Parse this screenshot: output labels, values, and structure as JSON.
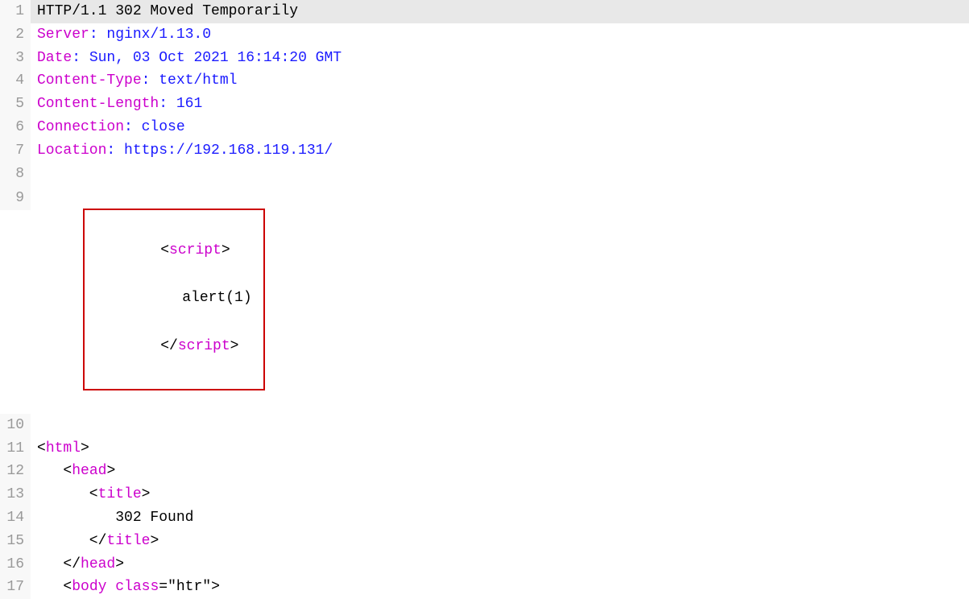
{
  "lines": [
    {
      "number": "1",
      "parts": [
        {
          "text": "HTTP/1.1 302 Moved Temporarily",
          "class": "plain"
        }
      ],
      "bg": "gray"
    },
    {
      "number": "2",
      "parts": [
        {
          "text": "Server",
          "class": "keyword"
        },
        {
          "text": ": nginx/1.13.0",
          "class": "value"
        }
      ],
      "bg": "white"
    },
    {
      "number": "3",
      "parts": [
        {
          "text": "Date",
          "class": "keyword"
        },
        {
          "text": ": Sun, 03 Oct 2021 16:14:20 GMT",
          "class": "value"
        }
      ],
      "bg": "white"
    },
    {
      "number": "4",
      "parts": [
        {
          "text": "Content-Type",
          "class": "keyword"
        },
        {
          "text": ": text/html",
          "class": "value"
        }
      ],
      "bg": "white"
    },
    {
      "number": "5",
      "parts": [
        {
          "text": "Content-Length",
          "class": "keyword"
        },
        {
          "text": ": 161",
          "class": "value"
        }
      ],
      "bg": "white"
    },
    {
      "number": "6",
      "parts": [
        {
          "text": "Connection",
          "class": "keyword"
        },
        {
          "text": ": close",
          "class": "value"
        }
      ],
      "bg": "white"
    },
    {
      "number": "7",
      "parts": [
        {
          "text": "Location",
          "class": "keyword"
        },
        {
          "text": ": https://192.168.119.131/",
          "class": "value"
        }
      ],
      "bg": "white"
    },
    {
      "number": "8",
      "parts": [],
      "bg": "white"
    },
    {
      "number": "9",
      "highlighted": true,
      "parts": [
        {
          "text": "<",
          "class": "keyword"
        },
        {
          "text": "script",
          "class": "keyword"
        },
        {
          "text": ">",
          "class": "keyword"
        }
      ],
      "inner_line": "    alert(1)",
      "close_parts": [
        {
          "text": "</",
          "class": "keyword"
        },
        {
          "text": "script",
          "class": "keyword"
        },
        {
          "text": ">",
          "class": "keyword"
        }
      ],
      "bg": "white"
    },
    {
      "number": "10",
      "parts": [],
      "bg": "white"
    },
    {
      "number": "11",
      "parts": [
        {
          "text": "<html>",
          "class": "keyword-tag"
        }
      ],
      "bg": "white"
    },
    {
      "number": "12",
      "parts": [
        {
          "text": "   <",
          "class": "plain"
        },
        {
          "text": "head",
          "class": "keyword"
        },
        {
          "text": ">",
          "class": "plain"
        }
      ],
      "bg": "white"
    },
    {
      "number": "13",
      "parts": [
        {
          "text": "      <",
          "class": "plain"
        },
        {
          "text": "title",
          "class": "keyword"
        },
        {
          "text": ">",
          "class": "plain"
        }
      ],
      "bg": "white"
    },
    {
      "number": "14",
      "parts": [
        {
          "text": "         302 Found",
          "class": "plain"
        }
      ],
      "bg": "white"
    },
    {
      "number": "15",
      "parts": [
        {
          "text": "      </",
          "class": "plain"
        },
        {
          "text": "title",
          "class": "keyword"
        },
        {
          "text": ">",
          "class": "plain"
        }
      ],
      "bg": "white"
    },
    {
      "number": "16",
      "parts": [
        {
          "text": "   </",
          "class": "plain"
        },
        {
          "text": "head",
          "class": "keyword"
        },
        {
          "text": ">",
          "class": "plain"
        }
      ],
      "bg": "white"
    },
    {
      "number": "17",
      "parts": [
        {
          "text": "   <",
          "class": "plain"
        },
        {
          "text": "body",
          "class": "keyword"
        },
        {
          "text": " ",
          "class": "plain"
        },
        {
          "text": "class",
          "class": "keyword"
        },
        {
          "text": "=\"htr\">",
          "class": "plain"
        }
      ],
      "bg": "white",
      "partial": true
    }
  ],
  "colors": {
    "keyword": "#cc00cc",
    "value": "#1a1aff",
    "plain": "#000000",
    "line_bg_gray": "#e8e8e8",
    "line_bg_white": "#ffffff",
    "line_number": "#999999",
    "highlight_border": "#cc0000"
  }
}
